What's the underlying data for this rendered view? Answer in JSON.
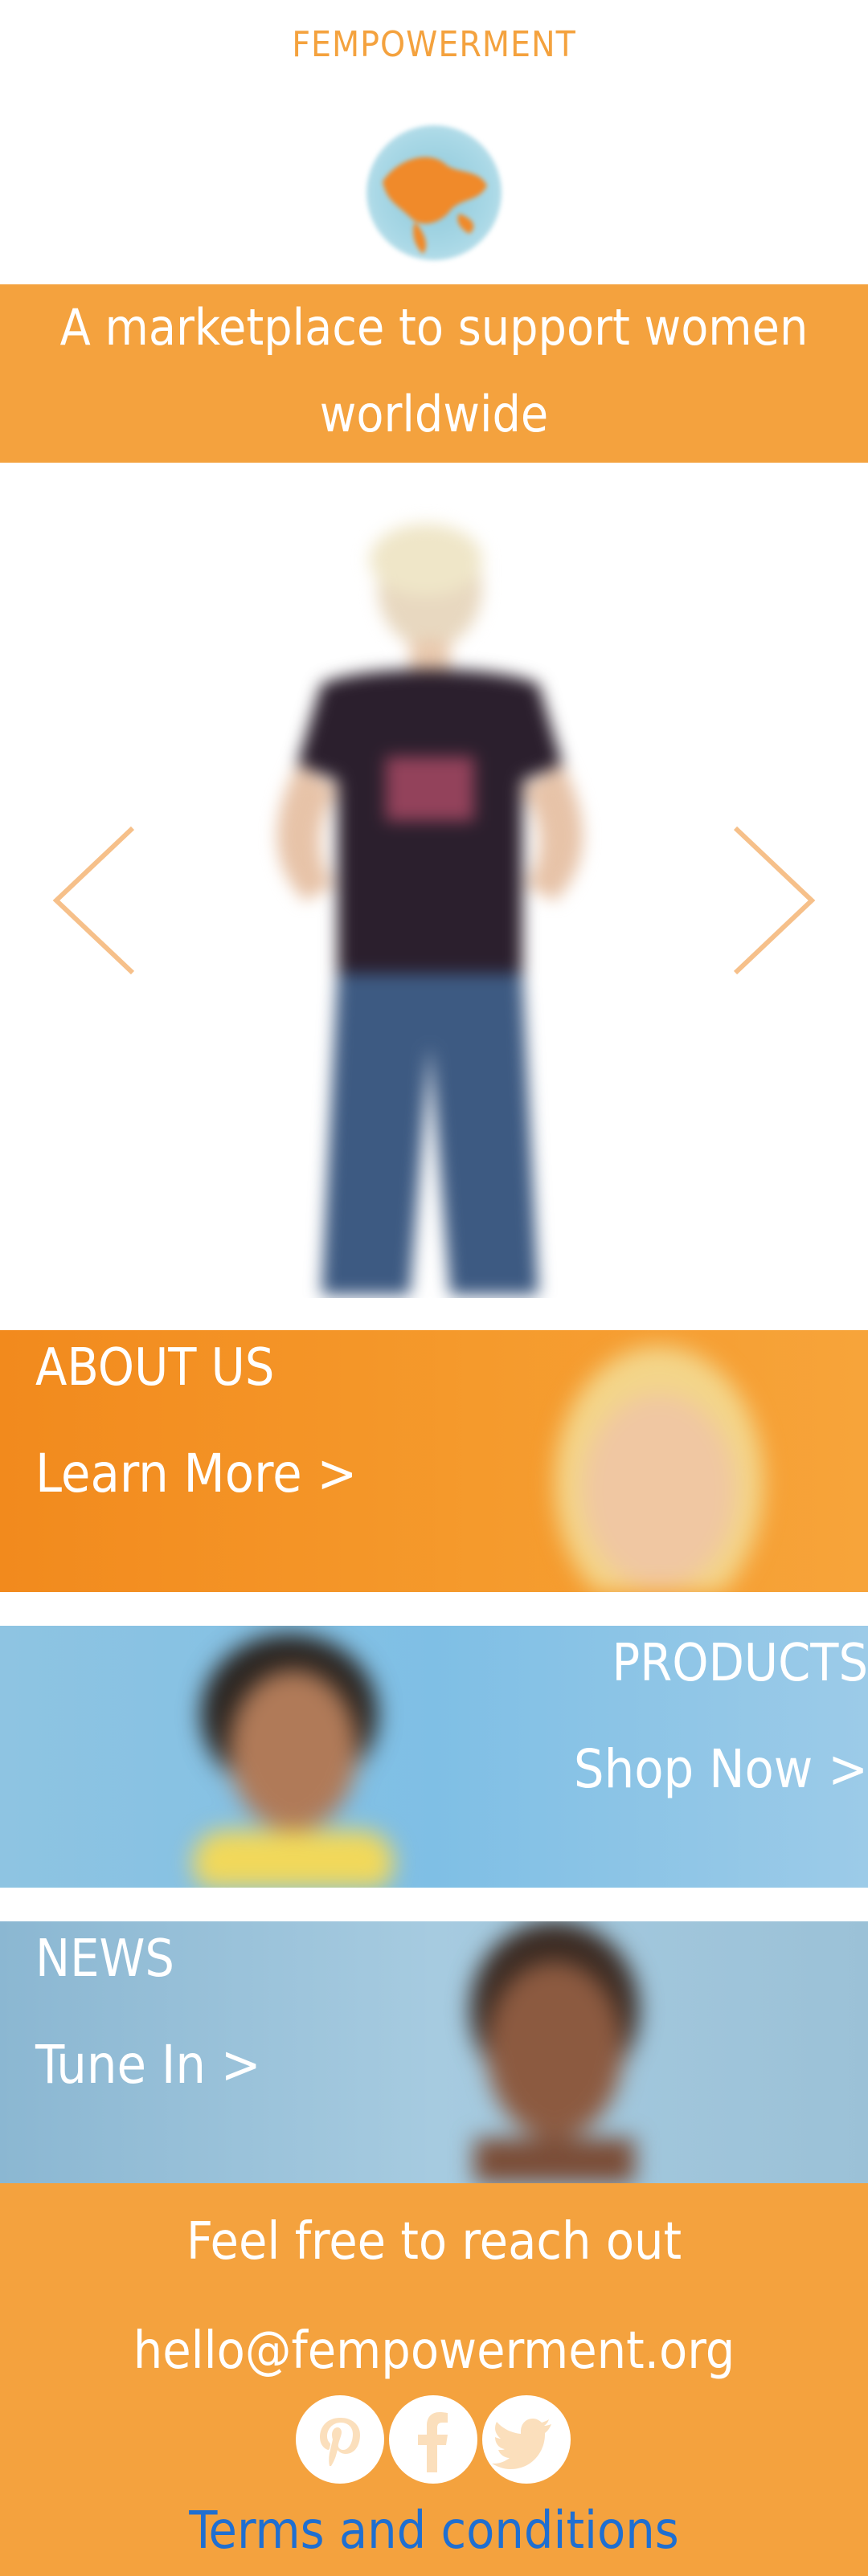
{
  "header": {
    "brand": "FEMPOWERMENT",
    "tagline": "A marketplace to support women worldwide"
  },
  "hero": {
    "prev_icon": "chevron-left-icon",
    "next_icon": "chevron-right-icon"
  },
  "banners": {
    "about": {
      "title": "ABOUT US",
      "link": "Learn More >"
    },
    "products": {
      "title": "PRODUCTS",
      "link": "Shop Now >"
    },
    "news": {
      "title": "NEWS",
      "link": "Tune In >"
    }
  },
  "footer": {
    "reach_out": "Feel free to reach out",
    "email": "hello@fempowerment.org",
    "social_icons": [
      "pinterest-icon",
      "facebook-icon",
      "twitter-icon"
    ],
    "terms": "Terms and conditions"
  },
  "colors": {
    "accent": "#f4a23e",
    "link": "#1f6fd1",
    "arrow": "#f6c08a"
  }
}
